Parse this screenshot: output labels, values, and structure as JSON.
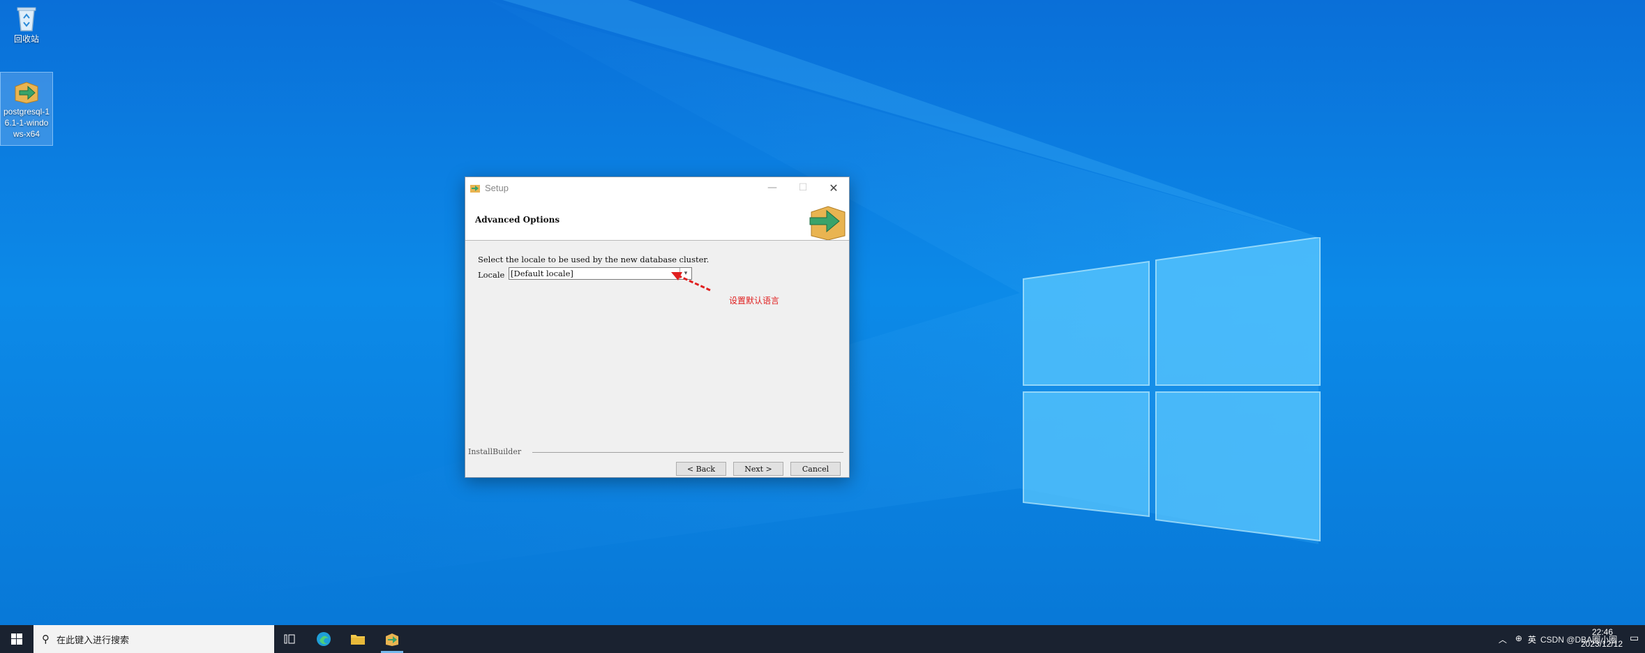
{
  "desktop": {
    "icons": [
      {
        "label": "回收站",
        "glyph": "recycle-bin-icon"
      },
      {
        "label": "postgresql-16.1-1-windows-x64",
        "glyph": "installer-icon"
      }
    ]
  },
  "dialog": {
    "window_title": "Setup",
    "header_title": "Advanced Options",
    "prompt": "Select the locale to be used by the new database cluster.",
    "locale_label": "Locale",
    "locale_value": "[Default locale]",
    "brand": "InstallBuilder",
    "buttons": {
      "back": "< Back",
      "next": "Next >",
      "cancel": "Cancel"
    }
  },
  "annotation": {
    "text": "设置默认语言",
    "color": "#e02020"
  },
  "taskbar": {
    "search_placeholder": "在此键入进行搜索",
    "tray": {
      "input_lang": "英",
      "ime": "CSDN @DBA圈小圈",
      "time": "22:46",
      "date": "2023/12/12"
    }
  },
  "colors": {
    "taskbar": "#1a2230",
    "accent": "#0a78d7"
  }
}
